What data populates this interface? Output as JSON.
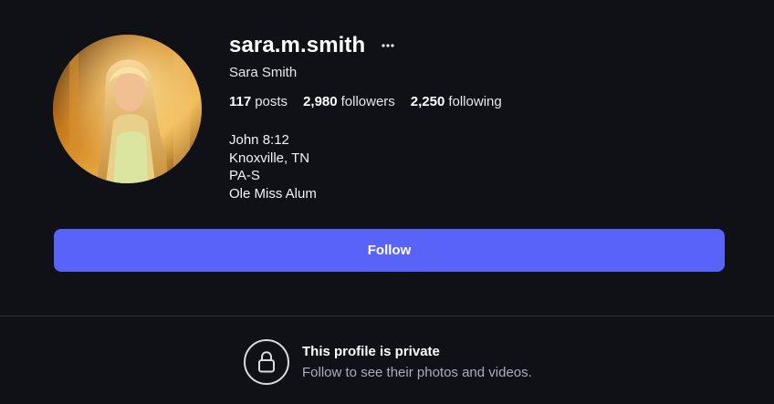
{
  "profile": {
    "username": "sara.m.smith",
    "display_name": "Sara Smith",
    "more_icon": "more-horizontal-icon",
    "stats": {
      "posts_count": "117",
      "posts_label": "posts",
      "followers_count": "2,980",
      "followers_label": "followers",
      "following_count": "2,250",
      "following_label": "following"
    },
    "bio": [
      "John 8:12",
      "Knoxville, TN",
      "PA-S",
      "Ole Miss Alum"
    ]
  },
  "actions": {
    "follow_label": "Follow"
  },
  "private_notice": {
    "icon": "lock-icon",
    "title": "This profile is private",
    "subtitle": "Follow to see their photos and videos."
  },
  "colors": {
    "background": "#0f1117",
    "accent": "#5963f7",
    "text_primary": "#ffffff",
    "text_secondary": "#a8adb8"
  }
}
